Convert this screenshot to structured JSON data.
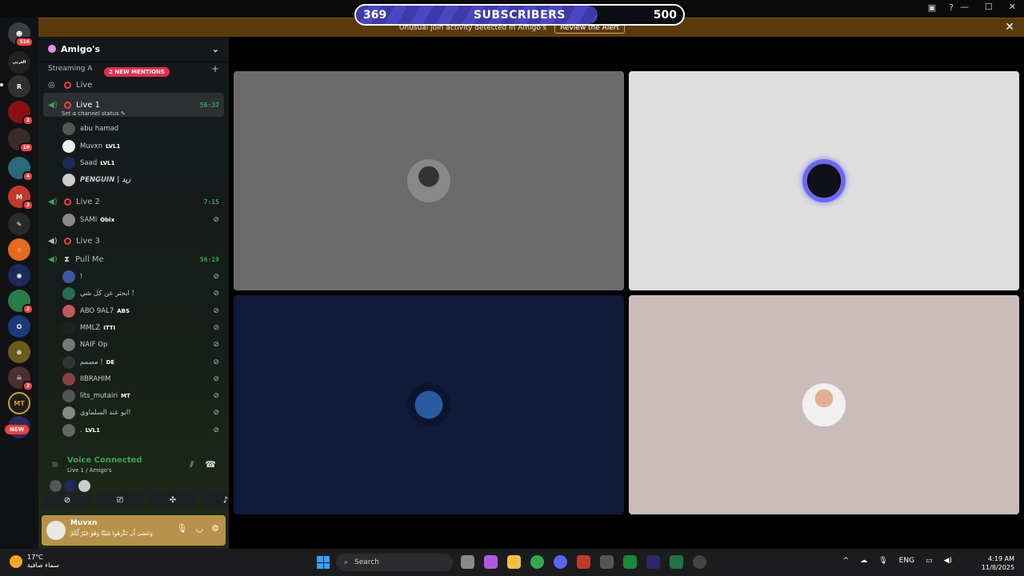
{
  "subscribers": {
    "current": "369",
    "label": "SUBSCRIBERS",
    "goal": "500",
    "progress_fraction": 0.738
  },
  "alert": {
    "text": "Unusual join activity detected in Amigo's",
    "button": "Review the Alert"
  },
  "rail": {
    "home_badge": "516",
    "server_label_1": "العربي",
    "new_label": "NEW"
  },
  "guild": {
    "name": "Amigo's"
  },
  "category": {
    "name": "Streaming A",
    "mentions": "2 NEW MENTIONS"
  },
  "channels": [
    {
      "name": "Live"
    },
    {
      "name": "Live 1",
      "timer": "56:37",
      "status": "Set a channel status"
    },
    {
      "name": "Live 2",
      "timer": "7:15"
    },
    {
      "name": "Live 3"
    },
    {
      "name": "Pull Me",
      "timer": "56:19"
    }
  ],
  "live1_users": [
    {
      "name": "abu hamad",
      "tag": ""
    },
    {
      "name": "Muvxn",
      "tag": "LVL1"
    },
    {
      "name": "Saad",
      "tag": "LVL1"
    },
    {
      "name": "PENGUIN | زيد",
      "tag": ""
    }
  ],
  "live2_users": [
    {
      "name": "SAMI",
      "tag": "Obix"
    }
  ],
  "pullme_users": [
    {
      "name": "!",
      "tag": ""
    },
    {
      "name": "ابحثر عن كل شي !",
      "tag": ""
    },
    {
      "name": "ABO 9AL7",
      "tag": "ABS"
    },
    {
      "name": "MMLZ",
      "tag": "ITTI"
    },
    {
      "name": "NAIF Op",
      "tag": ""
    },
    {
      "name": "مصمم !",
      "tag": "DE"
    },
    {
      "name": "IIBRAHIM",
      "tag": ""
    },
    {
      "name": "lits_mutairi",
      "tag": "MT"
    },
    {
      "name": "ابو عند السلماوي!",
      "tag": ""
    },
    {
      "name": ".",
      "tag": "LVL1"
    }
  ],
  "voice": {
    "title": "Voice Connected",
    "sub": "Live 1 / Amigo's"
  },
  "user": {
    "name": "Muvxn",
    "status": "وَعَسَىٰ أَن تَكْرَهُوا شَيْئًا وَهُوَ خَيْرٌ لَّكُمْ"
  },
  "taskbar": {
    "temp": "17°C",
    "weather": "سماء صافية",
    "search": "Search",
    "lang": "ENG",
    "time": "4:19 AM",
    "date": "11/8/2025"
  },
  "colors": {
    "accent_green": "#3ba55c",
    "live_red": "#f23f43",
    "alert_bg": "#5a3a0c",
    "userbar_gold": "#b8924a"
  }
}
